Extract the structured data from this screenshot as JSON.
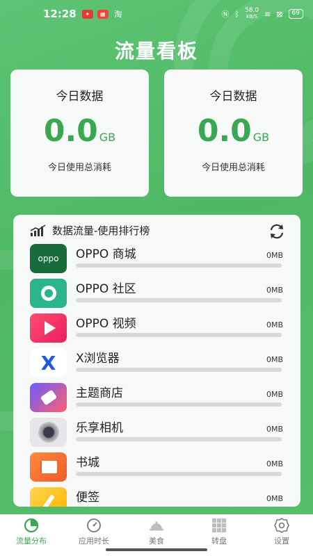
{
  "status_bar": {
    "time": "12:28",
    "net_speed": "58.0",
    "net_unit": "KB/S",
    "battery": "69"
  },
  "page_title": "流量看板",
  "stats": [
    {
      "title": "今日数据",
      "value": "0.0",
      "unit": "GB",
      "subtitle": "今日使用总消耗"
    },
    {
      "title": "今日数据",
      "value": "0.0",
      "unit": "GB",
      "subtitle": "今日使用总消耗"
    }
  ],
  "ranking": {
    "title": "数据流量-使用排行榜",
    "apps": [
      {
        "name": "OPPO 商城",
        "usage": "0MB",
        "fill": 0
      },
      {
        "name": "OPPO 社区",
        "usage": "0MB",
        "fill": 0
      },
      {
        "name": "OPPO 视频",
        "usage": "0MB",
        "fill": 0
      },
      {
        "name": "X浏览器",
        "usage": "0MB",
        "fill": 0
      },
      {
        "name": "主题商店",
        "usage": "0MB",
        "fill": 0
      },
      {
        "name": "乐享相机",
        "usage": "0MB",
        "fill": 0
      },
      {
        "name": "书城",
        "usage": "0MB",
        "fill": 0
      },
      {
        "name": "便签",
        "usage": "0MB",
        "fill": 0
      }
    ]
  },
  "tabs": [
    {
      "label": "流量分布",
      "icon": "pie-chart-icon",
      "active": true
    },
    {
      "label": "应用时长",
      "icon": "clock-icon",
      "active": false
    },
    {
      "label": "美食",
      "icon": "food-cloche-icon",
      "active": false
    },
    {
      "label": "转盘",
      "icon": "grid-icon",
      "active": false
    },
    {
      "label": "设置",
      "icon": "gear-icon",
      "active": false
    }
  ],
  "colors": {
    "accent": "#4fb865",
    "accent_text": "#3aa853"
  }
}
